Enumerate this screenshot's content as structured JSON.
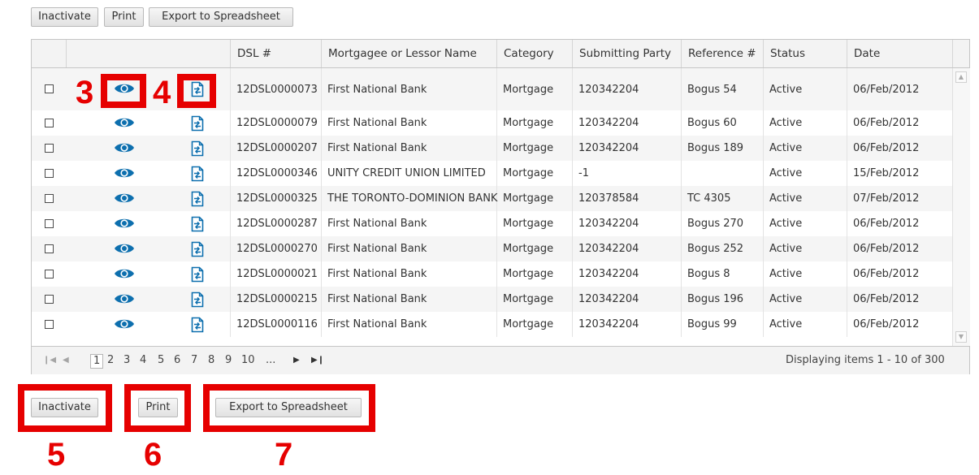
{
  "toolbar": {
    "inactivate": "Inactivate",
    "print": "Print",
    "export": "Export to Spreadsheet"
  },
  "columns": [
    "DSL #",
    "Mortgagee or Lessor Name",
    "Category",
    "Submitting Party",
    "Reference #",
    "Status",
    "Date"
  ],
  "rows": [
    {
      "dsl": "12DSL0000073",
      "name": "First National Bank",
      "category": "Mortgage",
      "party": "120342204",
      "ref": "Bogus 54",
      "status": "Active",
      "date": "06/Feb/2012"
    },
    {
      "dsl": "12DSL0000079",
      "name": "First National Bank",
      "category": "Mortgage",
      "party": "120342204",
      "ref": "Bogus 60",
      "status": "Active",
      "date": "06/Feb/2012"
    },
    {
      "dsl": "12DSL0000207",
      "name": "First National Bank",
      "category": "Mortgage",
      "party": "120342204",
      "ref": "Bogus 189",
      "status": "Active",
      "date": "06/Feb/2012"
    },
    {
      "dsl": "12DSL0000346",
      "name": "UNITY CREDIT UNION LIMITED",
      "category": "Mortgage",
      "party": "-1",
      "ref": "",
      "status": "Active",
      "date": "15/Feb/2012"
    },
    {
      "dsl": "12DSL0000325",
      "name": "THE TORONTO-DOMINION BANK",
      "category": "Mortgage",
      "party": "120378584",
      "ref": "TC 4305",
      "status": "Active",
      "date": "07/Feb/2012"
    },
    {
      "dsl": "12DSL0000287",
      "name": "First National Bank",
      "category": "Mortgage",
      "party": "120342204",
      "ref": "Bogus 270",
      "status": "Active",
      "date": "06/Feb/2012"
    },
    {
      "dsl": "12DSL0000270",
      "name": "First National Bank",
      "category": "Mortgage",
      "party": "120342204",
      "ref": "Bogus 252",
      "status": "Active",
      "date": "06/Feb/2012"
    },
    {
      "dsl": "12DSL0000021",
      "name": "First National Bank",
      "category": "Mortgage",
      "party": "120342204",
      "ref": "Bogus 8",
      "status": "Active",
      "date": "06/Feb/2012"
    },
    {
      "dsl": "12DSL0000215",
      "name": "First National Bank",
      "category": "Mortgage",
      "party": "120342204",
      "ref": "Bogus 196",
      "status": "Active",
      "date": "06/Feb/2012"
    },
    {
      "dsl": "12DSL0000116",
      "name": "First National Bank",
      "category": "Mortgage",
      "party": "120342204",
      "ref": "Bogus 99",
      "status": "Active",
      "date": "06/Feb/2012"
    }
  ],
  "pager": {
    "pages": [
      "1",
      "2",
      "3",
      "4",
      "5",
      "6",
      "7",
      "8",
      "9",
      "10",
      "..."
    ],
    "current": "1",
    "summary": "Displaying items 1 - 10 of 300"
  },
  "callouts": {
    "view": "3",
    "document": "4",
    "inactivate": "5",
    "print": "6",
    "export": "7"
  },
  "icons": {
    "row_view": "eye-icon",
    "row_document": "document-icon",
    "checkbox": "checkbox"
  },
  "colors": {
    "icon_blue": "#0d6fae",
    "highlight_red": "#e60000",
    "header_bg": "#f3f3f3",
    "alt_row_bg": "#f5f5f5"
  }
}
